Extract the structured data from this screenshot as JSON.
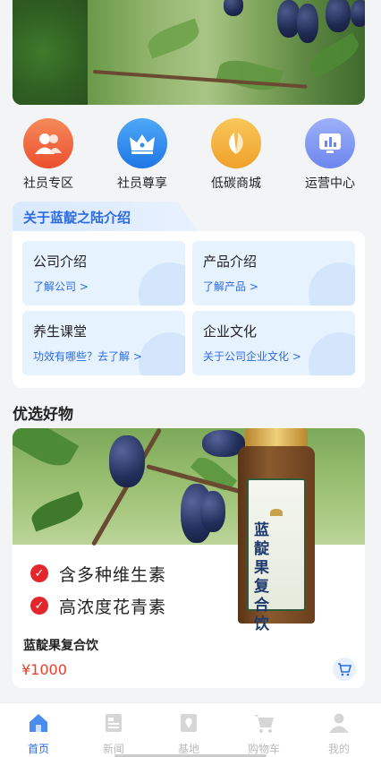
{
  "quick_links": [
    {
      "label": "社员专区",
      "icon": "members-icon",
      "color": "#f06a3c"
    },
    {
      "label": "社员尊享",
      "icon": "crown-icon",
      "color": "#2e8ef0"
    },
    {
      "label": "低碳商城",
      "icon": "leaf-icon",
      "color": "#f3b03a"
    },
    {
      "label": "运营中心",
      "icon": "chart-icon",
      "color": "#7b93f2"
    }
  ],
  "intro": {
    "title": "关于蓝靛之陆介绍",
    "cards": [
      {
        "title": "公司介绍",
        "link": "了解公司 >"
      },
      {
        "title": "产品介绍",
        "link": "了解产品 >"
      },
      {
        "title": "养生课堂",
        "link": "功效有哪些？去了解 >"
      },
      {
        "title": "企业文化",
        "link": "关于公司企业文化 >"
      }
    ]
  },
  "featured": {
    "section_title": "优选好物",
    "product": {
      "features": [
        "含多种维生素",
        "高浓度花青素"
      ],
      "bottle_label": "蓝靛果复合饮",
      "name": "蓝靛果复合饮",
      "price": "¥1000"
    }
  },
  "tabbar": [
    {
      "label": "首页",
      "icon": "home-icon",
      "active": true
    },
    {
      "label": "新闻",
      "icon": "news-icon",
      "active": false
    },
    {
      "label": "基地",
      "icon": "base-icon",
      "active": false
    },
    {
      "label": "购物车",
      "icon": "cart-icon",
      "active": false
    },
    {
      "label": "我的",
      "icon": "user-icon",
      "active": false
    }
  ],
  "colors": {
    "accent": "#2d6be0",
    "price": "#e8402a",
    "check": "#e3262c"
  }
}
